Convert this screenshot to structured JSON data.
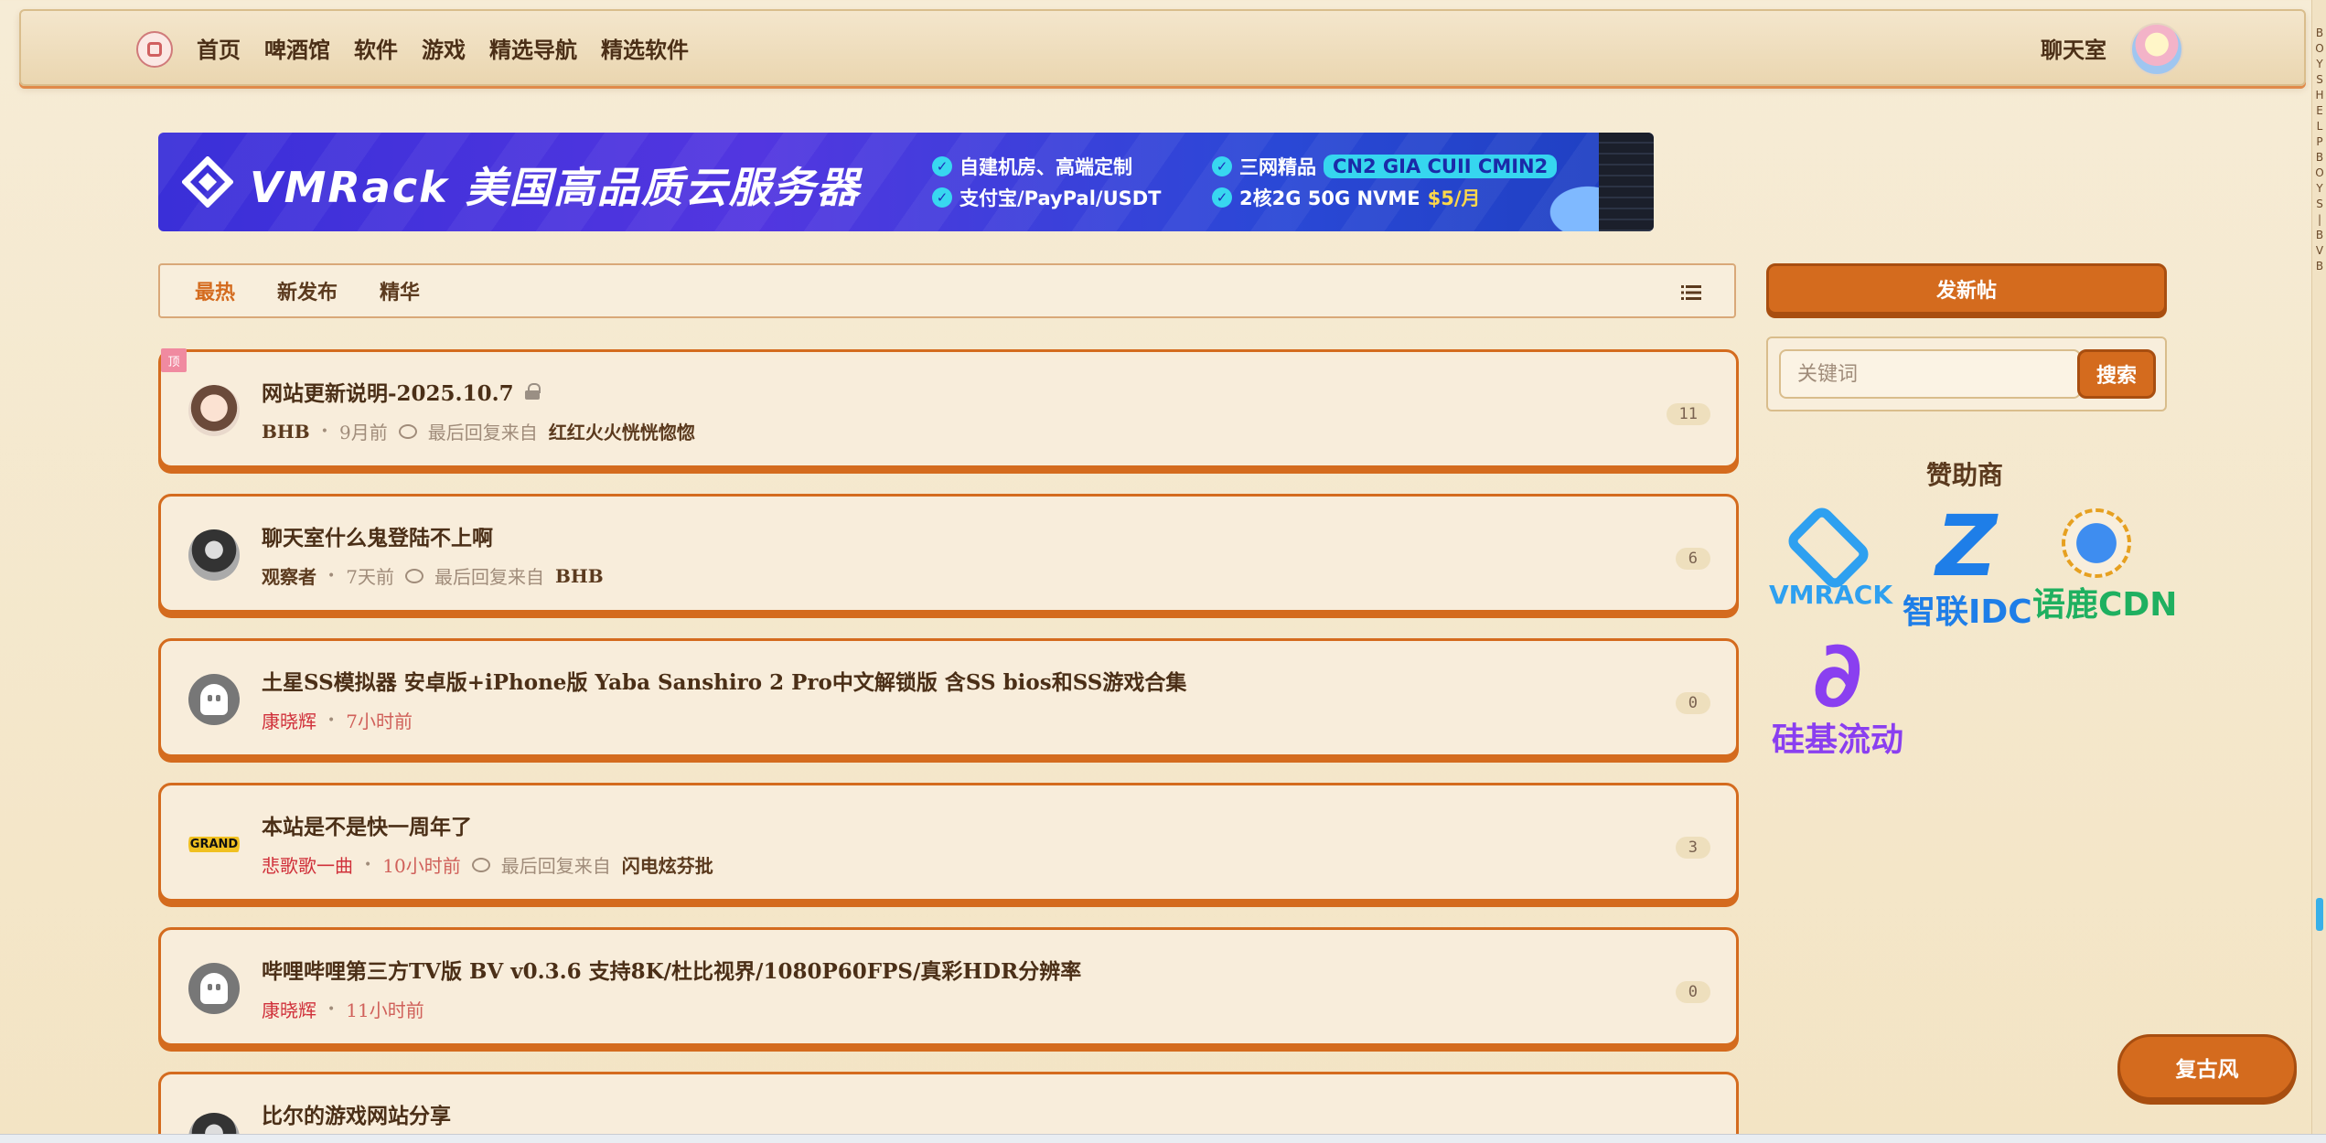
{
  "nav": {
    "links": [
      "首页",
      "啤酒馆",
      "软件",
      "游戏",
      "精选导航",
      "精选软件"
    ],
    "chat": "聊天室"
  },
  "banner": {
    "title": "VMRack 美国高品质云服务器",
    "features": [
      {
        "text": "自建机房、高端定制"
      },
      {
        "text": "三网精品",
        "pill": "CN2 GIA CUII CMIN2"
      },
      {
        "text": "支付宝/PayPal/USDT"
      },
      {
        "text": "2核2G 50G NVME",
        "price": "$5/月"
      }
    ]
  },
  "tabs": {
    "items": [
      "最热",
      "新发布",
      "精华"
    ],
    "active": "最热"
  },
  "posts": [
    {
      "title": "网站更新说明-2025.10.7",
      "locked": true,
      "pinned": true,
      "pin_label": "顶",
      "author": "BHB",
      "time": "9月前",
      "last_reply_label": "最后回复来自",
      "last_reply_user": "红红火火恍恍惚惚",
      "count": "11"
    },
    {
      "title": "聊天室什么鬼登陆不上啊",
      "locked": false,
      "pinned": false,
      "author": "观察者",
      "time": "7天前",
      "last_reply_label": "最后回复来自",
      "last_reply_user": "BHB",
      "count": "6"
    },
    {
      "title": "土星SS模拟器 安卓版+iPhone版 Yaba Sanshiro 2 Pro中文解锁版 含SS bios和SS游戏合集",
      "locked": false,
      "pinned": false,
      "author": "康晓辉",
      "time": "7小时前",
      "count": "0"
    },
    {
      "title": "本站是不是快一周年了",
      "locked": false,
      "pinned": false,
      "author": "悲歌歌一曲",
      "time": "10小时前",
      "last_reply_label": "最后回复来自",
      "last_reply_user": "闪电炫芬批",
      "count": "3",
      "avatar_text": "GRAND"
    },
    {
      "title": "哔哩哔哩第三方TV版 BV v0.3.6 支持8K/杜比视界/1080P60FPS/真彩HDR分辨率",
      "locked": false,
      "pinned": false,
      "author": "康晓辉",
      "time": "11小时前",
      "count": "0"
    },
    {
      "title": "比尔的游戏网站分享"
    }
  ],
  "sidebar": {
    "new_post": "发新帖",
    "search_placeholder": "关键词",
    "search_button": "搜索",
    "sponsor_title": "赞助商",
    "sponsors": [
      {
        "name": "VMRACK",
        "color": "#2ea0f0"
      },
      {
        "name": "智联IDC",
        "mark": "Z",
        "color": "#1e7ee8"
      },
      {
        "name": "语鹿CDN",
        "color": "#1fb060"
      },
      {
        "name": "硅基流动",
        "mark": "∂",
        "color": "#8a3ff0"
      }
    ]
  },
  "retro_button": "复古风",
  "edge_strip_text": "BOYS HELP BOYS | BVB",
  "colors": {
    "accent": "#d46b1e",
    "background": "#f6ecd6",
    "text": "#5b3a1e"
  }
}
